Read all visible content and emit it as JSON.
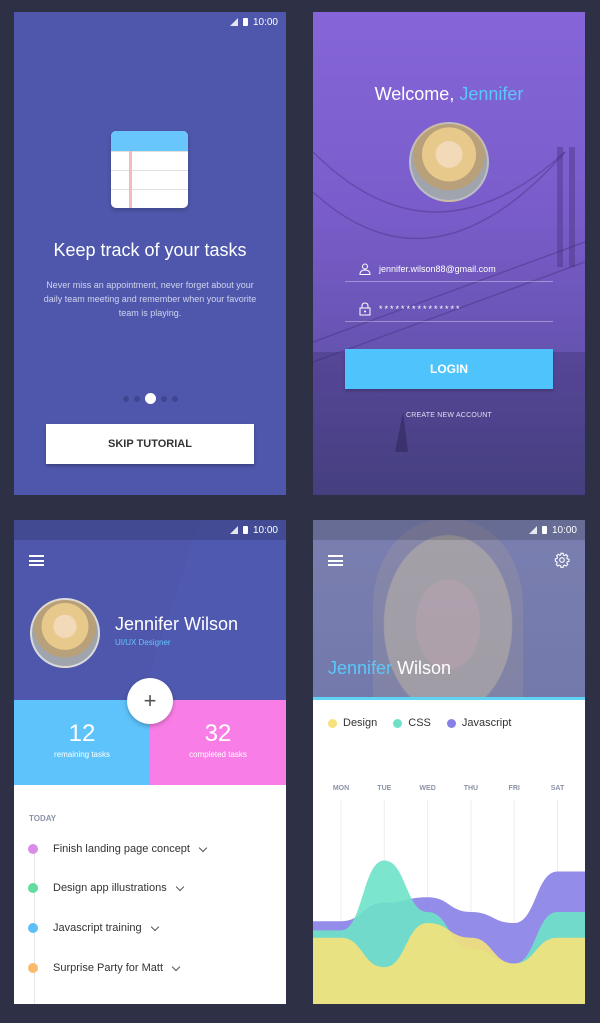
{
  "status_bar": {
    "time": "10:00"
  },
  "onboarding": {
    "title": "Keep track of your tasks",
    "description": "Never miss an appointment, never forget about your daily team meeting and remember when your favorite team is playing.",
    "pages": 5,
    "active_page": 3,
    "skip_label": "SKIP TUTORIAL"
  },
  "login": {
    "welcome_prefix": "Welcome, ",
    "welcome_name": "Jennifer",
    "email": "jennifer.wilson88@gmail.com",
    "password_mask": "***************",
    "login_label": "LOGIN",
    "create_account_label": "CREATE NEW ACCOUNT"
  },
  "profile": {
    "name": "Jennifer Wilson",
    "role": "UI/UX Designer",
    "remaining_count": "12",
    "remaining_label": "remaining tasks",
    "completed_count": "32",
    "completed_label": "completed tasks",
    "fab_label": "+",
    "section_label": "TODAY",
    "tasks": [
      {
        "title": "Finish landing page concept",
        "color": "#d98ce8"
      },
      {
        "title": "Design app illustrations",
        "color": "#62dca0"
      },
      {
        "title": "Javascript training",
        "color": "#5ebef8"
      },
      {
        "title": "Surprise Party for Matt",
        "color": "#fcb96a"
      }
    ],
    "colors": {
      "remaining": "#5ec3fb",
      "completed": "#f97de6",
      "header": "#4e57ab"
    }
  },
  "stats": {
    "first_name": "Jennifer",
    "last_name": "Wilson",
    "legend": [
      {
        "label": "Design",
        "color": "#f5e27a"
      },
      {
        "label": "CSS",
        "color": "#6ee2c8"
      },
      {
        "label": "Javascript",
        "color": "#8780e6"
      }
    ]
  },
  "chart_data": {
    "type": "area",
    "title": "",
    "xlabel": "",
    "ylabel": "",
    "categories": [
      "MON",
      "TUE",
      "WED",
      "THU",
      "FRI",
      "SAT"
    ],
    "ylim": [
      0,
      100
    ],
    "grid": true,
    "legend_position": "top-left",
    "series": [
      {
        "name": "Javascript",
        "color": "#8780e6",
        "values": [
          45,
          55,
          58,
          50,
          44,
          72
        ]
      },
      {
        "name": "CSS",
        "color": "#6ee2c8",
        "values": [
          40,
          78,
          50,
          30,
          22,
          50
        ]
      },
      {
        "name": "Design",
        "color": "#f5e27a",
        "values": [
          36,
          20,
          44,
          36,
          22,
          36
        ]
      }
    ]
  }
}
